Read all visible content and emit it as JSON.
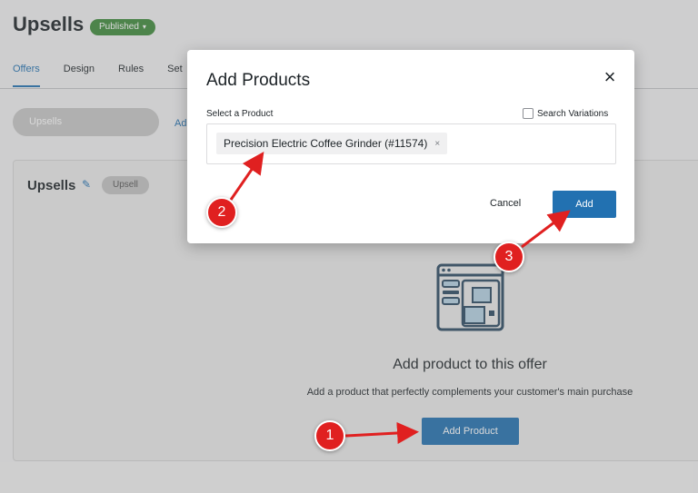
{
  "page": {
    "title": "Upsells",
    "status": "Published",
    "tabs": [
      "Offers",
      "Design",
      "Rules",
      "Set"
    ],
    "offer_pill": "Upsells",
    "add_link": "Ad"
  },
  "card": {
    "title": "Upsells",
    "type_badge": "Upsell",
    "empty_title": "Add product to this offer",
    "empty_desc": "Add a product that perfectly complements your customer's main purchase",
    "add_product_button": "Add Product"
  },
  "modal": {
    "title": "Add Products",
    "close": "×",
    "field_label": "Select a Product",
    "search_variations": "Search Variations",
    "selected_product": "Precision Electric Coffee Grinder (#11574)",
    "chip_remove": "×",
    "cancel": "Cancel",
    "add": "Add"
  },
  "markers": [
    "1",
    "2",
    "3"
  ],
  "colors": {
    "accent": "#2271b1",
    "published": "#3e8a3b",
    "marker": "#e02020"
  }
}
